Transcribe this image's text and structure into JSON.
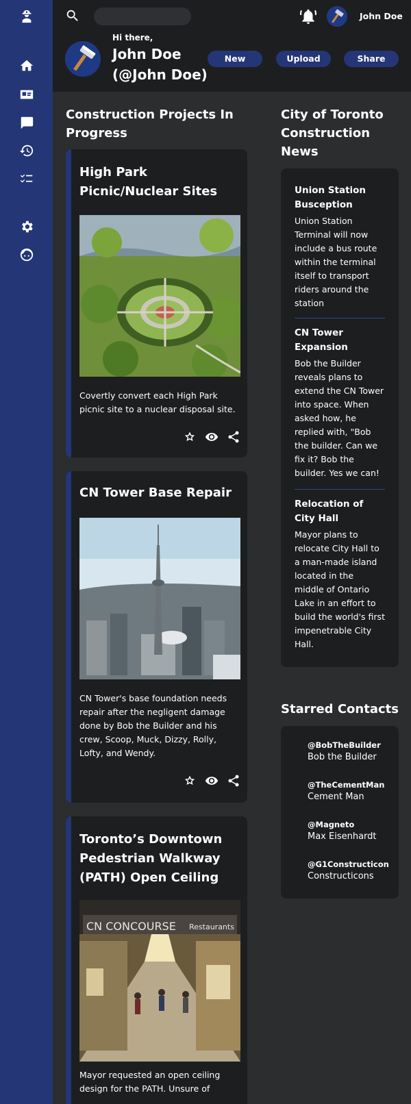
{
  "header": {
    "search_placeholder": "",
    "top_username": "John Doe",
    "greeting": "Hi there,",
    "user_name_line1": "John Doe",
    "user_name_line2": "(@John Doe)",
    "buttons": {
      "new": "New",
      "upload": "Upload",
      "share": "Share"
    }
  },
  "sidebar": {
    "icons": [
      "worker-icon",
      "home-icon",
      "id-card-icon",
      "chat-icon",
      "history-icon",
      "checklist-icon",
      "gear-icon",
      "face-icon"
    ]
  },
  "projects": {
    "heading": "Construction Projects In Progress",
    "items": [
      {
        "title": "High Park Picnic/Nuclear Sites",
        "description": "Covertly convert each High Park picnic site to a nuclear disposal site."
      },
      {
        "title": "CN Tower Base Repair",
        "description": "CN Tower's base foundation needs repair after the negligent damage done by Bob the Builder and his crew, Scoop, Muck, Dizzy, Rolly, Lofty, and Wendy."
      },
      {
        "title": "Toronto’s Downtown Pedestrian Walkway (PATH) Open Ceiling",
        "description": "Mayor requested an open ceiling design for the PATH. Unsure of",
        "image_sign": "CN CONCOURSE",
        "image_sign2": "Restaurants"
      }
    ]
  },
  "news": {
    "heading": "City of Toronto Construction News",
    "items": [
      {
        "title": "Union Station Busception",
        "body": "Union Station Terminal will now include a bus route within the terminal itself to transport riders around the station"
      },
      {
        "title": "CN Tower Expansion",
        "body": "Bob the Builder reveals plans to extend the CN Tower into space. When asked how, he replied with, \"Bob the builder. Can we fix it? Bob the builder. Yes we can!"
      },
      {
        "title": "Relocation of City Hall",
        "body": "Mayor plans to relocate City Hall to a man-made island located in the middle of Ontario Lake in an effort to build the world's first impenetrable City Hall."
      }
    ]
  },
  "contacts": {
    "heading": "Starred Contacts",
    "items": [
      {
        "handle": "@BobTheBuilder",
        "name": "Bob the Builder"
      },
      {
        "handle": "@TheCementMan",
        "name": "Cement Man"
      },
      {
        "handle": "@Magneto",
        "name": "Max Eisenhardt"
      },
      {
        "handle": "@G1Constructicon",
        "name": "Constructicons"
      }
    ]
  },
  "colors": {
    "sidebar": "#243676",
    "accent": "#243676",
    "panel": "#1d1e20",
    "background": "#2b2d2f"
  }
}
